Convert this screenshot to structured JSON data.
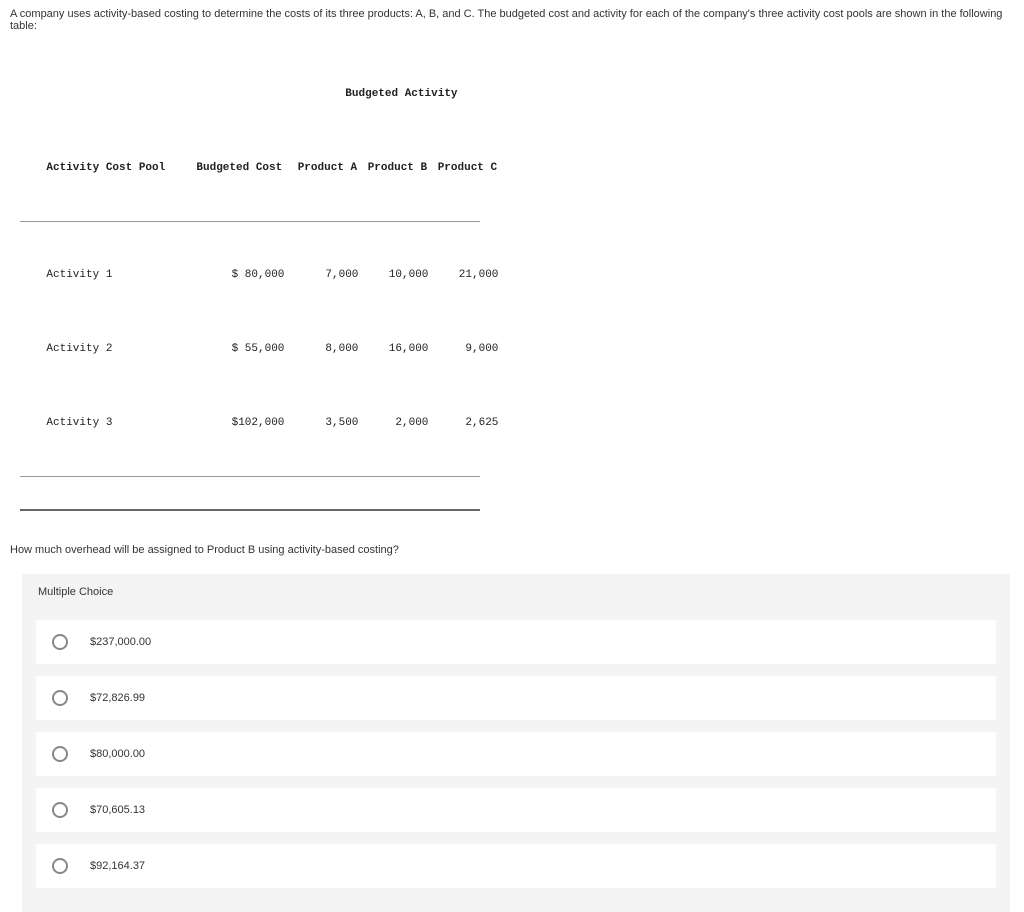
{
  "prompt": "A company uses activity-based costing to determine the costs of its three products: A, B, and C. The budgeted cost and activity for each of the company's three activity cost pools are shown in the following table:",
  "table": {
    "header_group": "Budgeted Activity",
    "col_pool": "Activity Cost Pool",
    "col_budget": "Budgeted Cost",
    "col_a": "Product A",
    "col_b": "Product B",
    "col_c": "Product C",
    "rows": [
      {
        "pool": "Activity 1",
        "budget": "$ 80,000",
        "a": "7,000",
        "b": "10,000",
        "c": "21,000"
      },
      {
        "pool": "Activity 2",
        "budget": "$ 55,000",
        "a": "8,000",
        "b": "16,000",
        "c": "9,000"
      },
      {
        "pool": "Activity 3",
        "budget": "$102,000",
        "a": "3,500",
        "b": "2,000",
        "c": "2,625"
      }
    ]
  },
  "question": "How much overhead will be assigned to Product B using activity-based costing?",
  "mc_title": "Multiple Choice",
  "options": [
    {
      "label": "$237,000.00"
    },
    {
      "label": "$72,826.99"
    },
    {
      "label": "$80,000.00"
    },
    {
      "label": "$70,605.13"
    },
    {
      "label": "$92,164.37"
    }
  ]
}
